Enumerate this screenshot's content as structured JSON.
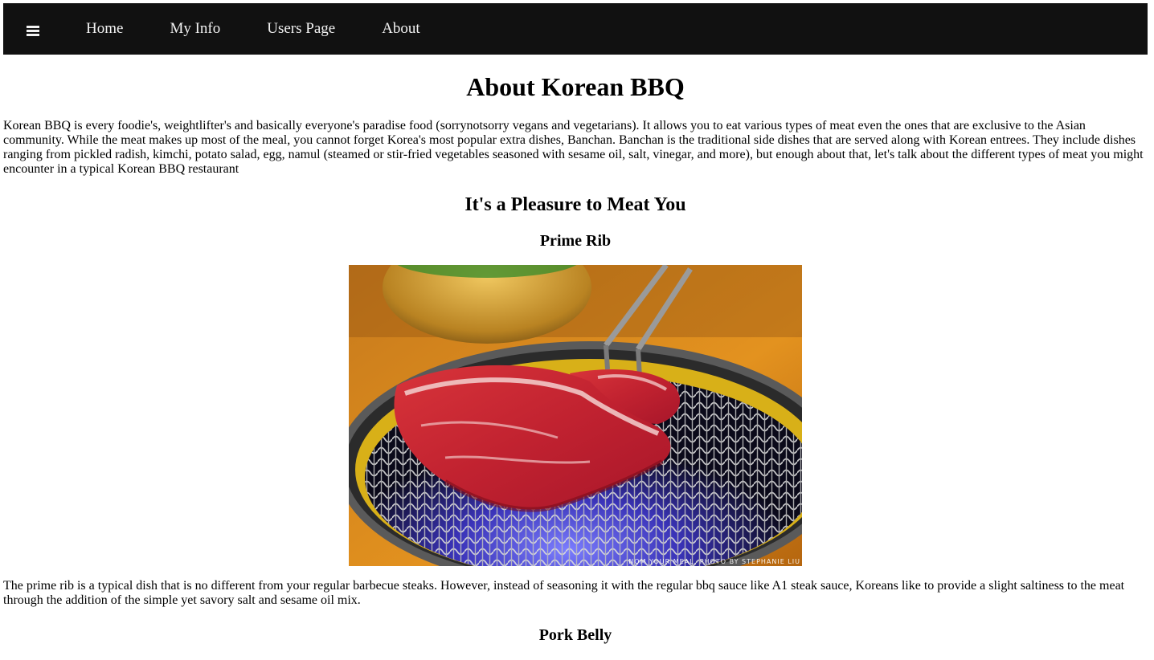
{
  "nav": {
    "menu_icon": "hamburger-icon",
    "links": [
      "Home",
      "My Info",
      "Users Page",
      "About"
    ]
  },
  "page": {
    "title": "About Korean BBQ",
    "intro": "Korean BBQ is every foodie's, weightlifter's and basically everyone's paradise food (sorrynotsorry vegans and vegetarians). It allows you to eat various types of meat even the ones that are exclusive to the Asian community. While the meat makes up most of the meal, you cannot forget Korea's most popular extra dishes, Banchan. Banchan is the traditional side dishes that are served along with Korean entrees. They include dishes ranging from pickled radish, kimchi, potato salad, egg, namul (steamed or stir-fried vegetables seasoned with sesame oil, salt, vinegar, and more), but enough about that, let's talk about the different types of meat you might encounter in a typical Korean BBQ restaurant",
    "section_title": "It's a Pleasure to Meat You"
  },
  "dishes": [
    {
      "title": "Prime Rib",
      "photo_credit": "Nom Your Meal. Photo by Stephanie Liu",
      "description": "The prime rib is a typical dish that is no different from your regular barbecue steaks. However, instead of seasoning it with the regular bbq sauce like A1 steak sauce, Koreans like to provide a slight saltiness to the meat through the addition of the simple yet savory salt and sesame oil mix."
    },
    {
      "title": "Pork Belly"
    }
  ],
  "colors": {
    "navbar_bg": "#111111",
    "navbar_text": "#f2f2f2"
  }
}
